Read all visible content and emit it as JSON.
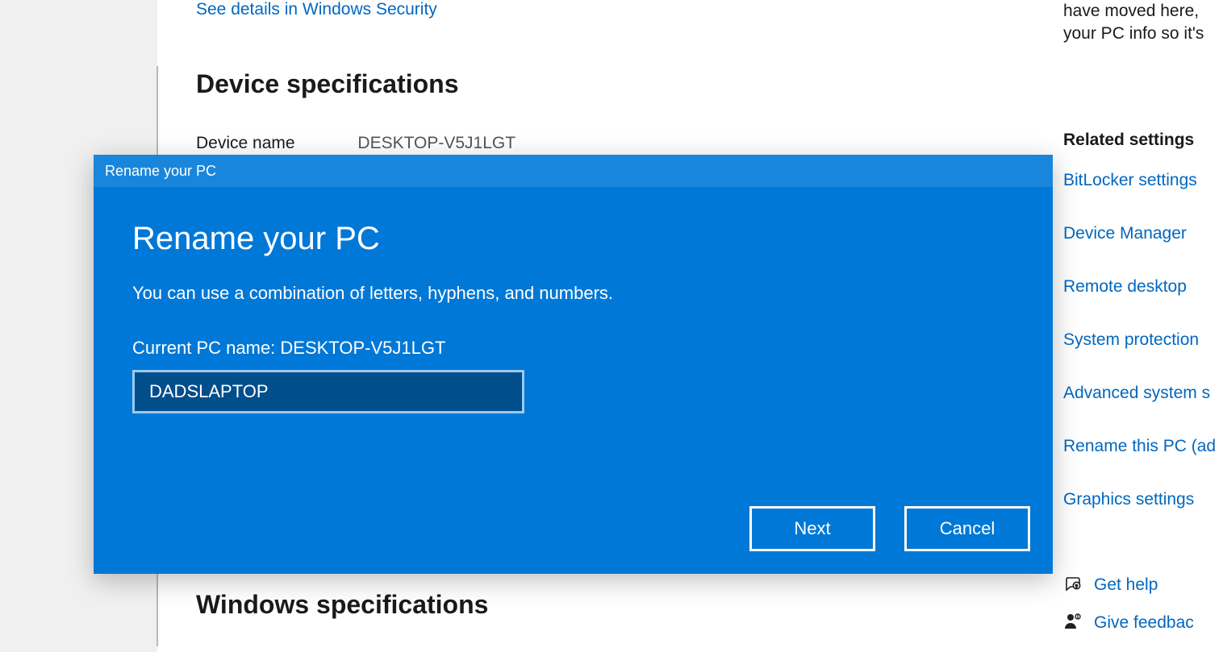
{
  "main": {
    "security_link": "See details in Windows Security",
    "device_spec_heading": "Device specifications",
    "device_name_label": "Device name",
    "device_name_value": "DESKTOP-V5J1LGT",
    "windows_spec_heading": "Windows specifications"
  },
  "sidebar": {
    "hint_line1": "have moved here,",
    "hint_line2": "your PC info so it's",
    "related_heading": "Related settings",
    "links": {
      "bitlocker": "BitLocker settings",
      "device_manager": "Device Manager",
      "remote_desktop": "Remote desktop",
      "system_protection": "System protection",
      "advanced_system": "Advanced system s",
      "rename_pc": "Rename this PC (ad",
      "graphics": "Graphics settings"
    },
    "help": {
      "get_help": "Get help",
      "give_feedback": "Give feedbac"
    }
  },
  "dialog": {
    "titlebar": "Rename your PC",
    "heading": "Rename your PC",
    "description": "You can use a combination of letters, hyphens, and numbers.",
    "current_label": "Current PC name: DESKTOP-V5J1LGT",
    "input_value": "DADSLAPTOP",
    "next_label": "Next",
    "cancel_label": "Cancel"
  }
}
